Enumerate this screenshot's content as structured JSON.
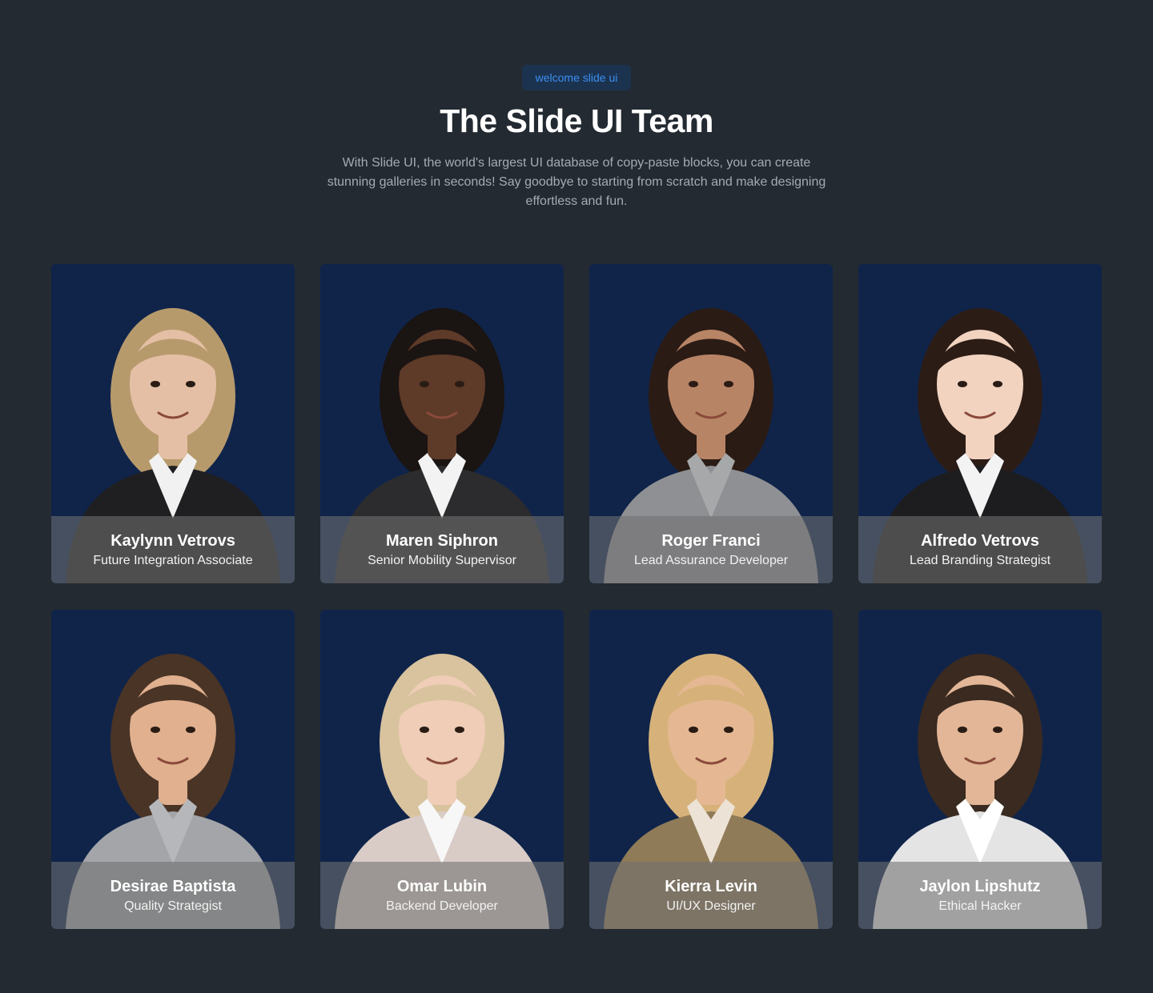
{
  "header": {
    "badge": "welcome slide ui",
    "title": "The Slide UI Team",
    "subtitle": "With Slide UI, the world's largest UI database of copy-paste blocks, you can create stunning galleries in seconds! Say goodbye to starting from scratch and make designing effortless and fun."
  },
  "members": [
    {
      "name": "Kaylynn Vetrovs",
      "role": "Future Integration Associate",
      "hair": "#b79a6c",
      "skin": "#e4bfa5",
      "outfit": "#1f1f22",
      "collar": "#f1f1f1"
    },
    {
      "name": "Maren Siphron",
      "role": "Senior Mobility Supervisor",
      "hair": "#1a1412",
      "skin": "#5e3a28",
      "outfit": "#2c2c2e",
      "collar": "#f3f3f3"
    },
    {
      "name": "Roger Franci",
      "role": "Lead Assurance Developer",
      "hair": "#2a1b14",
      "skin": "#b88466",
      "outfit": "#8f9093",
      "collar": "#a7a8aa"
    },
    {
      "name": "Alfredo Vetrovs",
      "role": "Lead Branding Strategist",
      "hair": "#2b1c16",
      "skin": "#f1d3c0",
      "outfit": "#1d1d20",
      "collar": "#f3f3f3"
    },
    {
      "name": "Desirae Baptista",
      "role": "Quality Strategist",
      "hair": "#4a3426",
      "skin": "#e0b08f",
      "outfit": "#a3a5a8",
      "collar": "#b5b7ba"
    },
    {
      "name": "Omar Lubin",
      "role": "Backend Developer",
      "hair": "#d8c39e",
      "skin": "#efcdb6",
      "outfit": "#d9ccc7",
      "collar": "#f7f7f7"
    },
    {
      "name": "Kierra Levin",
      "role": "UI/UX Designer",
      "hair": "#d6b27a",
      "skin": "#e5b893",
      "outfit": "#8f7b57",
      "collar": "#ece3d6"
    },
    {
      "name": "Jaylon Lipshutz",
      "role": "Ethical Hacker",
      "hair": "#3a2a20",
      "skin": "#e2b697",
      "outfit": "#e4e4e4",
      "collar": "#ffffff"
    }
  ]
}
